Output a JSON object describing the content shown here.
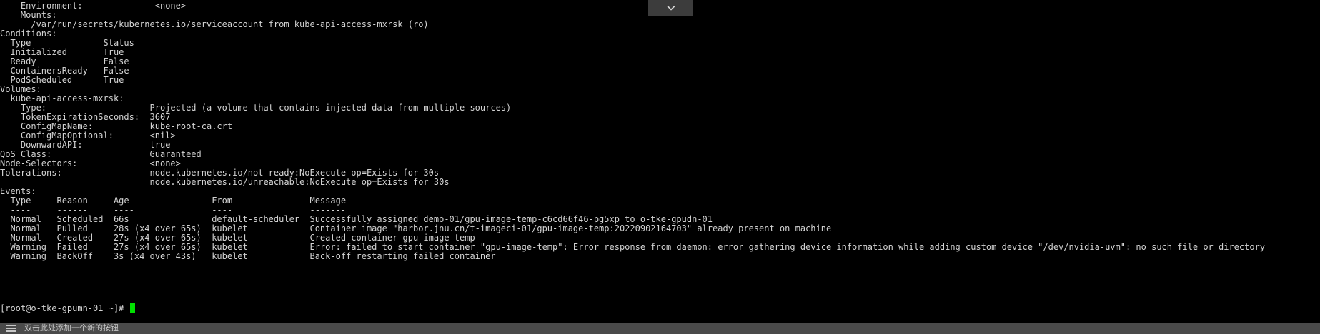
{
  "terminal": {
    "lines": [
      "    Environment:              <none>",
      "    Mounts:",
      "      /var/run/secrets/kubernetes.io/serviceaccount from kube-api-access-mxrsk (ro)",
      "Conditions:",
      "  Type              Status",
      "  Initialized       True",
      "  Ready             False",
      "  ContainersReady   False",
      "  PodScheduled      True",
      "Volumes:",
      "  kube-api-access-mxrsk:",
      "    Type:                    Projected (a volume that contains injected data from multiple sources)",
      "    TokenExpirationSeconds:  3607",
      "    ConfigMapName:           kube-root-ca.crt",
      "    ConfigMapOptional:       <nil>",
      "    DownwardAPI:             true",
      "QoS Class:                   Guaranteed",
      "Node-Selectors:              <none>",
      "Tolerations:                 node.kubernetes.io/not-ready:NoExecute op=Exists for 30s",
      "                             node.kubernetes.io/unreachable:NoExecute op=Exists for 30s",
      "Events:",
      "  Type     Reason     Age                From               Message",
      "  ----     ------     ----               ----               -------",
      "  Normal   Scheduled  66s                default-scheduler  Successfully assigned demo-01/gpu-image-temp-c6cd66f46-pg5xp to o-tke-gpudn-01",
      "  Normal   Pulled     28s (x4 over 65s)  kubelet            Container image \"harbor.jnu.cn/t-imageci-01/gpu-image-temp:20220902164703\" already present on machine",
      "  Normal   Created    27s (x4 over 65s)  kubelet            Created container gpu-image-temp",
      "  Warning  Failed     27s (x4 over 65s)  kubelet            Error: failed to start container \"gpu-image-temp\": Error response from daemon: error gathering device information while adding custom device \"/dev/nvidia-uvm\": no such file or directory",
      "  Warning  BackOff    3s (x4 over 43s)   kubelet            Back-off restarting failed container",
      "[root@o-tke-gpumn-01 ~]# "
    ]
  },
  "bottom_bar": {
    "label": "双击此处添加一个新的按钮"
  },
  "colors": {
    "background": "#000000",
    "text": "#d3d3d3",
    "cursor": "#00e000",
    "bar": "#4a4a4a"
  },
  "icons": {
    "collapse": "chevron-down-icon",
    "menu": "menu-icon"
  }
}
